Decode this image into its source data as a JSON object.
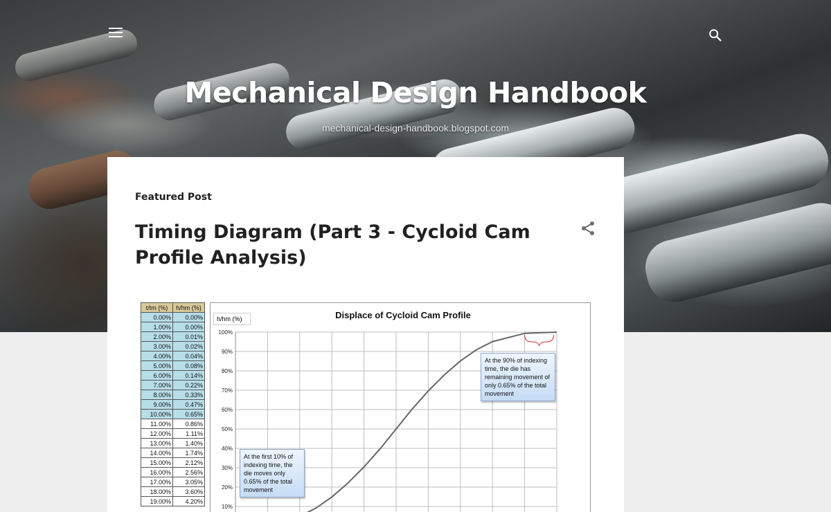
{
  "header": {
    "blog_title": "Mechanical Design Handbook",
    "blog_subtitle": "mechanical-design-handbook.blogspot.com",
    "menu_icon": "hamburger-menu-icon",
    "search_icon": "search-icon"
  },
  "featured": {
    "label": "Featured Post",
    "post_title": "Timing Diagram (Part 3 - Cycloid Cam Profile Analysis)",
    "share_icon": "share-icon"
  },
  "figure_table": {
    "headers": [
      "t/tm (%)",
      "h/hm (%)"
    ],
    "rows": [
      [
        "0.00%",
        "0.00%"
      ],
      [
        "1.00%",
        "0.00%"
      ],
      [
        "2.00%",
        "0.01%"
      ],
      [
        "3.00%",
        "0.02%"
      ],
      [
        "4.00%",
        "0.04%"
      ],
      [
        "5.00%",
        "0.08%"
      ],
      [
        "6.00%",
        "0.14%"
      ],
      [
        "7.00%",
        "0.22%"
      ],
      [
        "8.00%",
        "0.33%"
      ],
      [
        "9.00%",
        "0.47%"
      ],
      [
        "10.00%",
        "0.65%"
      ],
      [
        "11.00%",
        "0.86%"
      ],
      [
        "12.00%",
        "1.11%"
      ],
      [
        "13.00%",
        "1.40%"
      ],
      [
        "14.00%",
        "1.74%"
      ],
      [
        "15.00%",
        "2.12%"
      ],
      [
        "16.00%",
        "2.56%"
      ],
      [
        "17.00%",
        "3.05%"
      ],
      [
        "18.00%",
        "3.60%"
      ],
      [
        "19.00%",
        "4.20%"
      ]
    ],
    "highlight_through_row": 10
  },
  "chart_data": {
    "type": "line",
    "title": "Displace of Cycloid Cam Profile",
    "ylabel": "h/hm (%)",
    "ylim": [
      0,
      100
    ],
    "xlim": [
      0,
      100
    ],
    "y_ticks": [
      "10%",
      "20%",
      "30%",
      "40%",
      "50%",
      "60%",
      "70%",
      "80%",
      "90%",
      "100%"
    ],
    "grid": true,
    "series": [
      {
        "x": [
          0,
          10,
          20,
          25,
          30,
          35,
          40,
          45,
          50,
          55,
          60,
          65,
          70,
          75,
          80,
          90,
          100
        ],
        "y": [
          0,
          0.65,
          4.9,
          9.1,
          14.9,
          22.1,
          30.4,
          39.7,
          50,
          60.3,
          69.6,
          77.9,
          85.1,
          90.9,
          95.1,
          99.35,
          100
        ]
      }
    ],
    "annotations": [
      "At the 90% of indexing time, the die has remaining movement of only 0.65% of the total movement",
      "At the first 10% of indexing time, the die moves only 0.65% of the total movement"
    ],
    "line_color": "#666666"
  }
}
